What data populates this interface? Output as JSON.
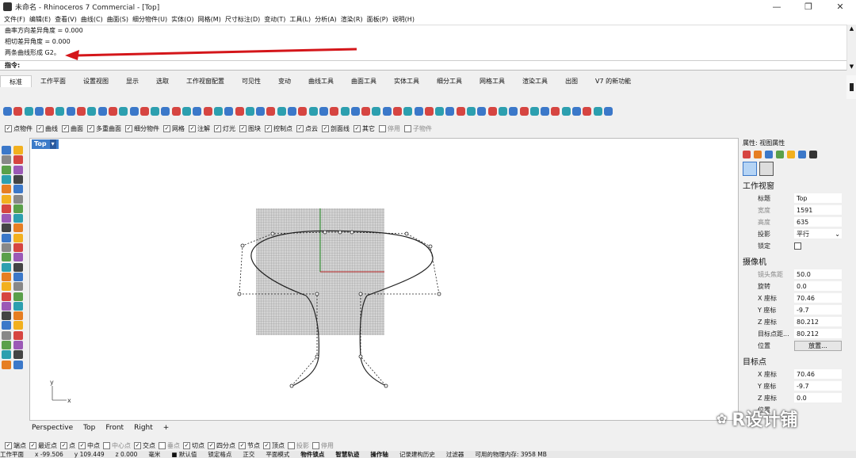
{
  "window": {
    "title": "未命名 - Rhinoceros 7 Commercial - [Top]",
    "buttons": [
      "—",
      "❐",
      "✕"
    ]
  },
  "menu": [
    "文件(F)",
    "编辑(E)",
    "查看(V)",
    "曲线(C)",
    "曲面(S)",
    "细分物件(U)",
    "实体(O)",
    "网格(M)",
    "尺寸标注(D)",
    "变动(T)",
    "工具(L)",
    "分析(A)",
    "渲染(R)",
    "面板(P)",
    "说明(H)"
  ],
  "command_history": [
    "曲率方向差异角度 = 0.000",
    "相切差异角度 = 0.000",
    "两条曲线形成 G2。"
  ],
  "command": {
    "prompt": "指令:",
    "value": ""
  },
  "toolbar_tabs": [
    "标准",
    "工作平面",
    "设置视图",
    "显示",
    "选取",
    "工作视窗配置",
    "可见性",
    "变动",
    "曲线工具",
    "曲面工具",
    "实体工具",
    "细分工具",
    "网格工具",
    "渲染工具",
    "出图",
    "V7 的新功能"
  ],
  "active_tab": "标准",
  "filter_bar": [
    "点物件",
    "曲线",
    "曲面",
    "多重曲面",
    "细分物件",
    "网格",
    "注解",
    "灯光",
    "图块",
    "控制点",
    "点云",
    "剖面线",
    "其它",
    "停用",
    "子物件"
  ],
  "viewport": {
    "name": "Top",
    "menu_icon": "▾",
    "axis_x": "x",
    "axis_y": "y"
  },
  "view_tabs": [
    "Perspective",
    "Top",
    "Front",
    "Right",
    "+"
  ],
  "properties": {
    "title": "属性: 视图属性",
    "viewport_section": "工作视窗",
    "title_label": "标题",
    "title_value": "Top",
    "width_label": "宽度",
    "width_value": "1591",
    "height_label": "高度",
    "height_value": "635",
    "projection_label": "投影",
    "projection_value": "平行",
    "projection_arrow": "⌄",
    "locked_label": "锁定",
    "camera_section": "摄像机",
    "lens_label": "镜头焦距",
    "lens_value": "50.0",
    "rotation_label": "旋转",
    "rotation_value": "0.0",
    "cx_label": "X 座标",
    "cx_value": "70.46",
    "cy_label": "Y 座标",
    "cy_value": "-9.7",
    "cz_label": "Z 座标",
    "cz_value": "80.212",
    "dist_label": "目标点距...",
    "dist_value": "80.212",
    "position_label": "位置",
    "position_button": "放置...",
    "target_section": "目标点",
    "tx_label": "X 座标",
    "tx_value": "70.46",
    "ty_label": "Y 座标",
    "ty_value": "-9.7",
    "tz_label": "Z 座标",
    "tz_value": "0.0",
    "tpos_label": "位置"
  },
  "osnaps": [
    {
      "label": "端点",
      "on": true
    },
    {
      "label": "最近点",
      "on": true
    },
    {
      "label": "点",
      "on": true
    },
    {
      "label": "中点",
      "on": true
    },
    {
      "label": "中心点",
      "on": false
    },
    {
      "label": "交点",
      "on": true
    },
    {
      "label": "垂点",
      "on": false
    },
    {
      "label": "切点",
      "on": true
    },
    {
      "label": "四分点",
      "on": true
    },
    {
      "label": "节点",
      "on": true
    },
    {
      "label": "顶点",
      "on": true
    },
    {
      "label": "投影",
      "on": false
    },
    {
      "label": "停用",
      "on": false
    }
  ],
  "status": [
    "工作平面",
    "x -99.506",
    "y 109.449",
    "z 0.000",
    "毫米",
    "■ 默认值",
    "锁定格点",
    "正交",
    "平面模式",
    "物件锁点",
    "智慧轨迹",
    "操作轴",
    "记录建构历史",
    "过滤器",
    "可用的物理内存: 3958 MB"
  ],
  "watermark": "R设计铺"
}
